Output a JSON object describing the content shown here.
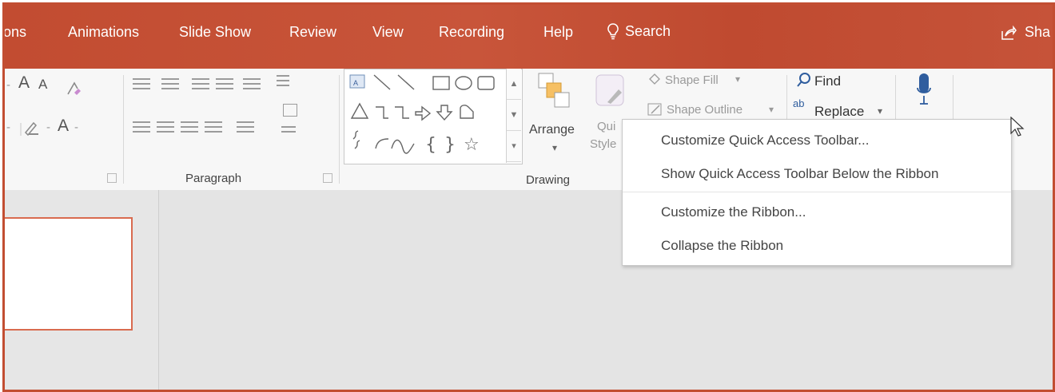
{
  "colors": {
    "accent": "#c24c31",
    "ribbon": "#f7f7f7",
    "workspace": "#e4e4e4",
    "slide_border": "#d96b4f"
  },
  "tabs": [
    {
      "label": "ons"
    },
    {
      "label": "Animations"
    },
    {
      "label": "Slide Show"
    },
    {
      "label": "Review"
    },
    {
      "label": "View"
    },
    {
      "label": "Recording"
    },
    {
      "label": "Help"
    }
  ],
  "search": {
    "label": "Search",
    "icon": "lightbulb-icon"
  },
  "share": {
    "label": "Sha",
    "icon": "share-icon"
  },
  "ribbon": {
    "font": {
      "grow": "A",
      "shrink": "A",
      "color": "A"
    },
    "paragraph_label": "Paragraph",
    "arrange": {
      "label": "Arrange",
      "chevron": "▾"
    },
    "quick_styles": {
      "line1": "Qui",
      "line2": "Style"
    },
    "drawing_label": "Drawing",
    "shape_fill": "Shape Fill",
    "shape_outline": "Shape Outline",
    "find": "Find",
    "replace": "Replace",
    "replace_prefix": "ab"
  },
  "context_menu": {
    "items": [
      {
        "label": "Customize Quick Access Toolbar..."
      },
      {
        "label": "Show Quick Access Toolbar Below the Ribbon"
      },
      {
        "label": "Customize the Ribbon..."
      },
      {
        "label": "Collapse the Ribbon"
      }
    ]
  }
}
